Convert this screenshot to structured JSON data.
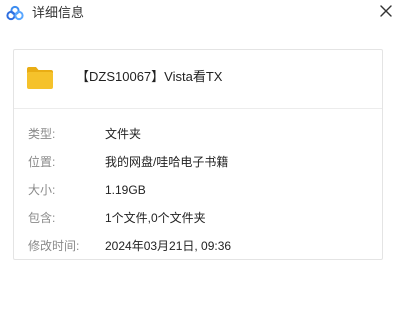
{
  "window": {
    "title": "详细信息",
    "app_icon": "cloud-icon",
    "close_icon": "close-icon"
  },
  "file": {
    "icon": "folder-icon",
    "name": "【DZS10067】Vista看TX"
  },
  "properties": [
    {
      "label": "类型:",
      "value": "文件夹"
    },
    {
      "label": "位置:",
      "value": "我的网盘/哇哈电子书籍"
    },
    {
      "label": "大小:",
      "value": "1.19GB"
    },
    {
      "label": "包含:",
      "value": "1个文件,0个文件夹"
    },
    {
      "label": "修改时间:",
      "value": "2024年03月21日, 09:36"
    }
  ],
  "colors": {
    "folder": "#f5c22b",
    "folder_dark": "#e9ad14",
    "label": "#8a8a8a",
    "border": "#e4e4e4"
  }
}
